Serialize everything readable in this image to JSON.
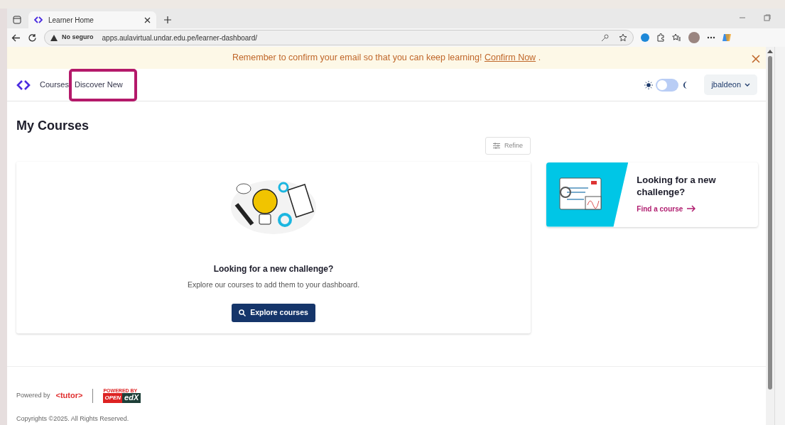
{
  "browser": {
    "tab": {
      "title": "Learner Home"
    },
    "address_bar": {
      "security": "No seguro",
      "url": "apps.aulavirtual.undar.edu.pe/learner-dashboard/"
    }
  },
  "banner": {
    "message": "Remember to confirm your email so that you can keep learning!",
    "link": "Confirm Now",
    "suffix": "."
  },
  "header": {
    "nav": [
      {
        "label": "Courses",
        "annotated": false
      },
      {
        "label": "Discover New",
        "annotated": true
      }
    ],
    "theme_toggle": {
      "on": false
    },
    "user_menu": "jbaldeon"
  },
  "main": {
    "title": "My Courses",
    "refine_button": "Refine",
    "empty_state": {
      "heading": "Looking for a new challenge?",
      "text": "Explore our courses to add them to your dashboard.",
      "button": "Explore courses"
    },
    "sidebar_card": {
      "heading": "Looking for a new challenge?",
      "link": "Find a course"
    }
  },
  "footer": {
    "powered_by": "Powered by",
    "tutor_logo": "<tutor>",
    "openedx_logo": {
      "badge": "POWERED BY",
      "open": "OPEN",
      "edx": "edX"
    },
    "copyright": "Copyrights ©2025. All Rights Reserved."
  }
}
